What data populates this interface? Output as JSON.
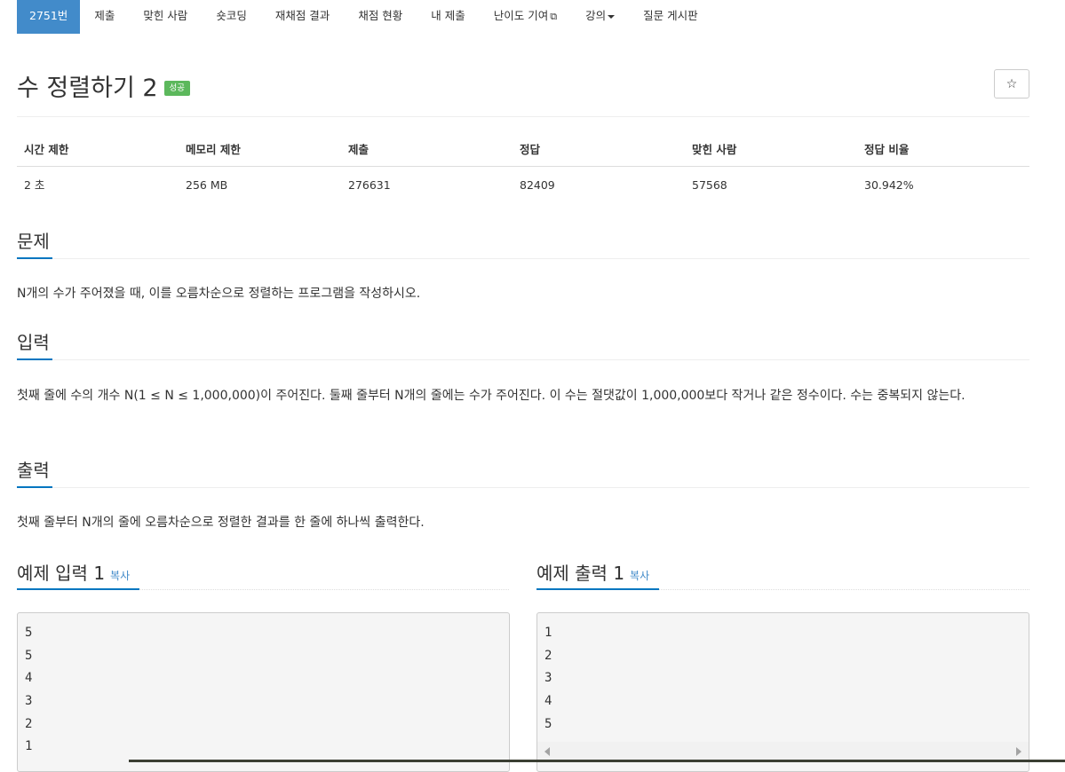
{
  "nav": {
    "problem_id": "2751번",
    "items": [
      "제출",
      "맞힌 사람",
      "숏코딩",
      "재채점 결과",
      "채점 현황",
      "내 제출",
      "난이도 기여",
      "강의",
      "질문 게시판"
    ]
  },
  "problem": {
    "title": "수 정렬하기 2",
    "status_badge": "성공",
    "star_icon": "☆"
  },
  "info": {
    "headers": [
      "시간 제한",
      "메모리 제한",
      "제출",
      "정답",
      "맞힌 사람",
      "정답 비율"
    ],
    "values": [
      "2 초",
      "256 MB",
      "276631",
      "82409",
      "57568",
      "30.942%"
    ]
  },
  "sections": {
    "problem": {
      "title": "문제",
      "text": "N개의 수가 주어졌을 때, 이를 오름차순으로 정렬하는 프로그램을 작성하시오."
    },
    "input": {
      "title": "입력",
      "text": "첫째 줄에 수의 개수 N(1 ≤ N ≤ 1,000,000)이 주어진다. 둘째 줄부터 N개의 줄에는 수가 주어진다. 이 수는 절댓값이 1,000,000보다 작거나 같은 정수이다. 수는 중복되지 않는다."
    },
    "output": {
      "title": "출력",
      "text": "첫째 줄부터 N개의 줄에 오름차순으로 정렬한 결과를 한 줄에 하나씩 출력한다."
    }
  },
  "examples": {
    "input": {
      "title": "예제 입력 1",
      "copy": "복사",
      "lines": [
        "5",
        "5",
        "4",
        "3",
        "2",
        "1"
      ]
    },
    "output": {
      "title": "예제 출력 1",
      "copy": "복사",
      "lines": [
        "1",
        "2",
        "3",
        "4",
        "5"
      ]
    }
  },
  "colors": {
    "accent": "#428bca",
    "success": "#5cb85c",
    "section_underline": "#0076c0"
  }
}
